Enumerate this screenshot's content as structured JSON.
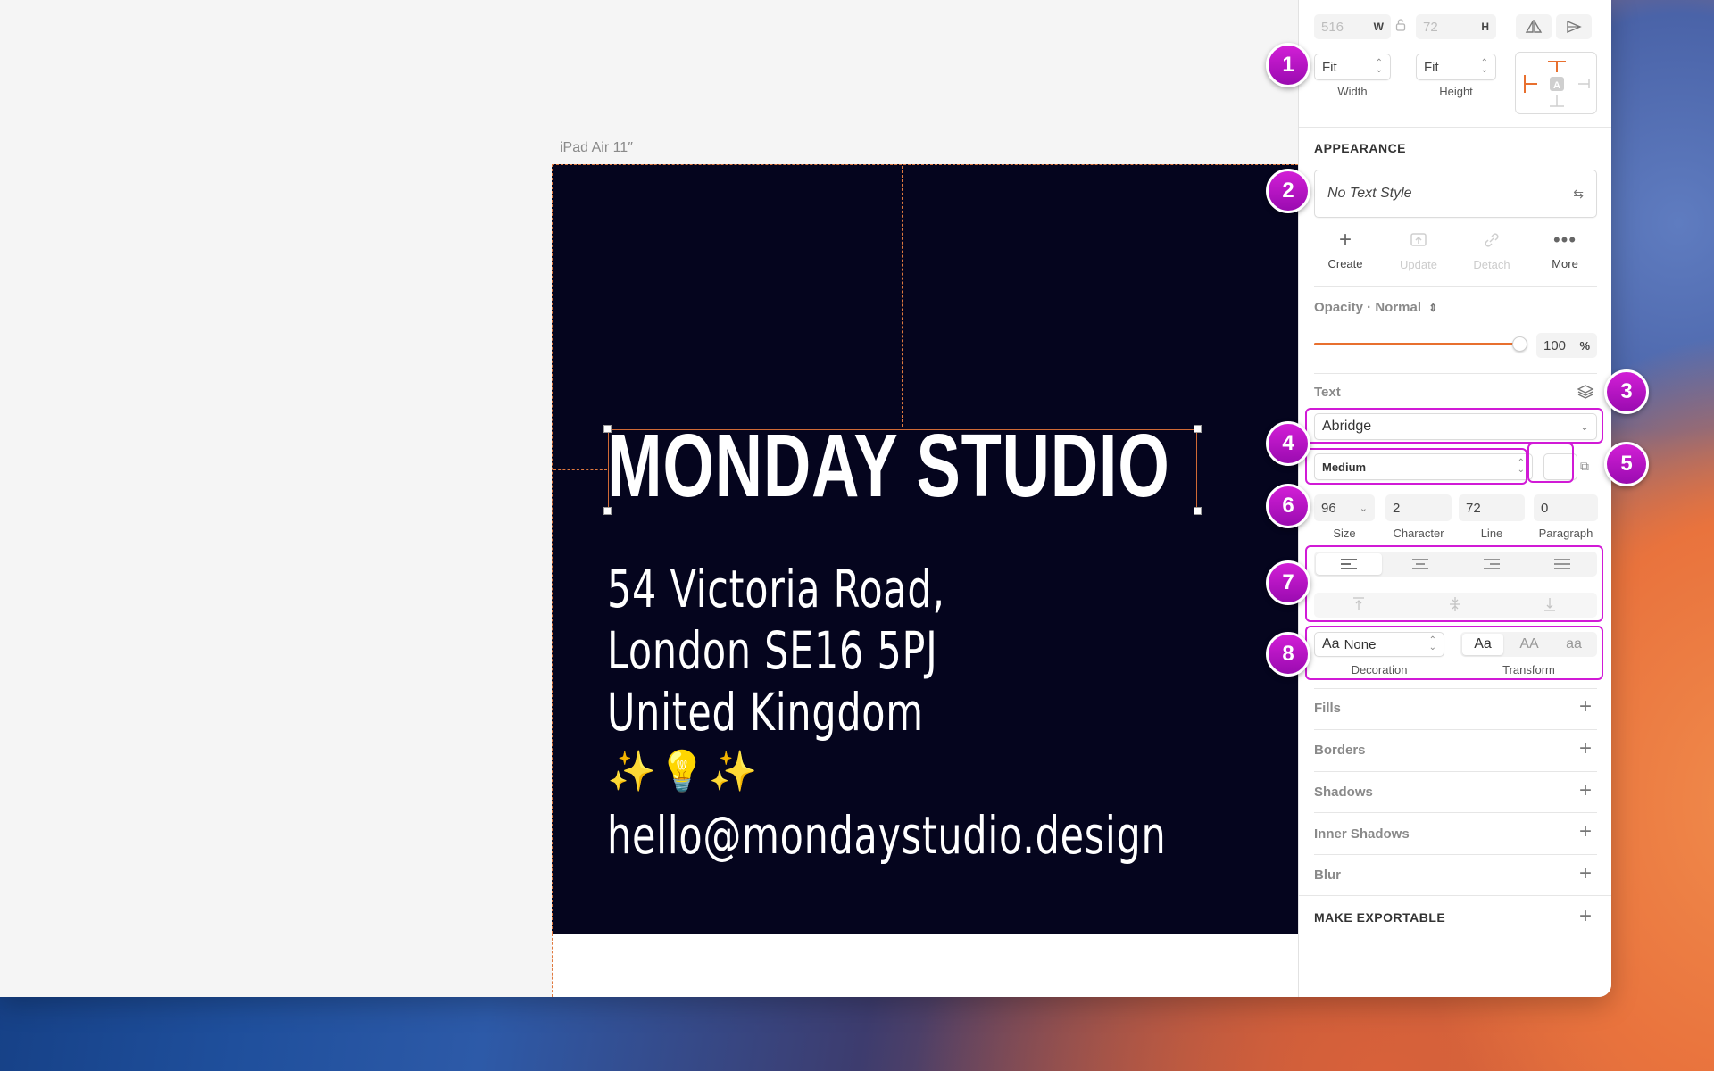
{
  "canvas": {
    "artboard_label": "iPad Air 11″",
    "heading": "MONDAY STUDIO",
    "address_lines": [
      "54 Victoria Road,",
      "London SE16 5PJ",
      "United Kingdom"
    ],
    "emoji_line": "✨💡✨",
    "email": "hello@mondaystudio.design"
  },
  "inspector": {
    "size": {
      "width_value": "516",
      "width_label": "W",
      "height_value": "72",
      "height_label": "H"
    },
    "resizing": {
      "width_mode": "Fit",
      "width_caption": "Width",
      "height_mode": "Fit",
      "height_caption": "Height"
    },
    "appearance": {
      "title": "APPEARANCE",
      "text_style": "No Text Style",
      "actions": [
        "Create",
        "Update",
        "Detach",
        "More"
      ],
      "opacity_label": "Opacity · Normal",
      "opacity_value": "100",
      "opacity_unit": "%",
      "opacity_fraction": 1.0
    },
    "text": {
      "title": "Text",
      "font_family": "Abridge",
      "font_weight": "Medium",
      "size": "96",
      "size_caption": "Size",
      "character": "2",
      "character_caption": "Character",
      "line": "72",
      "line_caption": "Line",
      "paragraph": "0",
      "paragraph_caption": "Paragraph",
      "decoration_value": "None",
      "decoration_prefix": "Aa",
      "decoration_caption": "Decoration",
      "transform_options": [
        "Aa",
        "AA",
        "aa"
      ],
      "transform_caption": "Transform"
    },
    "sections": [
      "Fills",
      "Borders",
      "Shadows",
      "Inner Shadows",
      "Blur"
    ],
    "export_title": "MAKE EXPORTABLE"
  },
  "badges": [
    "1",
    "2",
    "3",
    "4",
    "5",
    "6",
    "7",
    "8"
  ],
  "colors": {
    "accent": "#e8702f",
    "badge": "#c013c8",
    "artboard": "#05051e"
  }
}
